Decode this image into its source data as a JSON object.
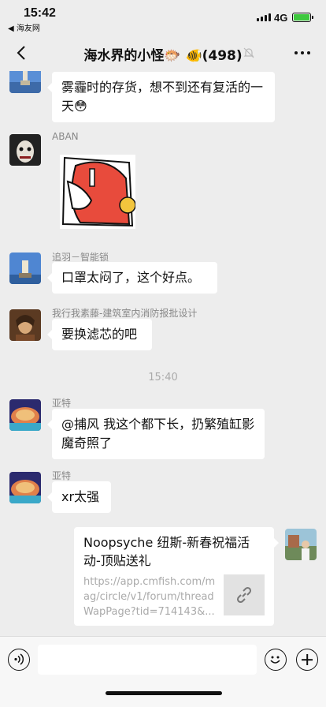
{
  "status_bar": {
    "time": "15:42",
    "back_app": "◀ 海友网",
    "network": "4G",
    "battery_color": "#3ec83e"
  },
  "nav": {
    "title": "海水界的小怪🐡 🐠(498)"
  },
  "messages": [
    {
      "text": "雾霾时的存货，想不到还有复活的一天😳"
    },
    {
      "sender": "ABAN"
    },
    {
      "sender": "追羽－智能锁",
      "text": "口罩太闷了，这个好点。"
    },
    {
      "sender": "我行我素藤-建筑室内消防报批设计",
      "text": "要换滤芯的吧"
    },
    {
      "sender": "亚特",
      "text": "@捕风 我这个都下长，扔繁殖缸影魔奇照了"
    },
    {
      "sender": "亚特",
      "text": "xr太强"
    }
  ],
  "timestamp": "15:40",
  "link_card": {
    "title": "Noopsyche 纽斯-新春祝福活动-顶贴送礼",
    "url": "https://app.cmfish.com/mag/circle/v1/forum/threadWapPage?tid=714143&..."
  },
  "icons": {
    "back": "chevron-left-icon",
    "mute": "mute-bell-icon",
    "more": "more-dots-icon",
    "voice": "voice-icon",
    "emoji": "emoji-icon",
    "plus": "plus-icon",
    "link": "link-icon"
  }
}
